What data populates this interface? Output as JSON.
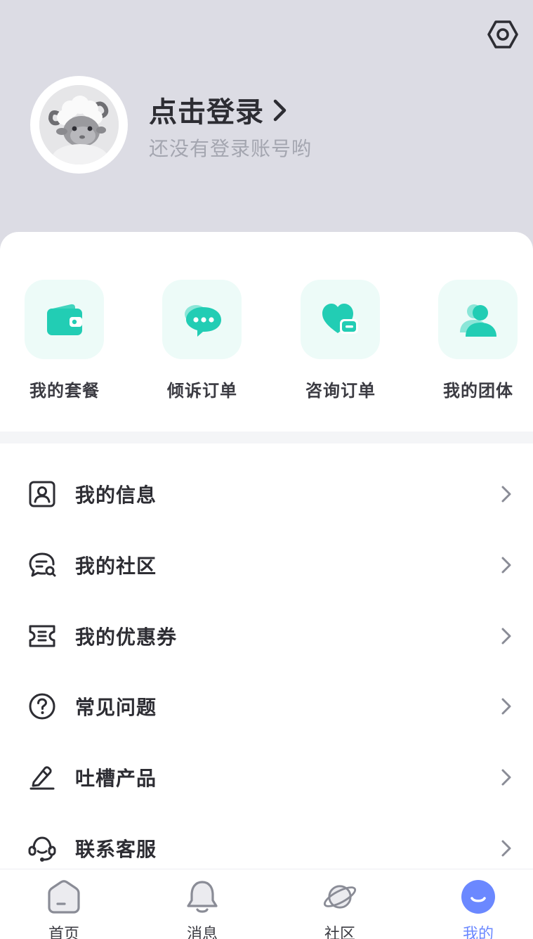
{
  "header": {
    "login_title": "点击登录",
    "login_subtitle": "还没有登录账号哟",
    "settings_icon": "settings-hexagon-icon",
    "avatar_icon": "sheep-avatar"
  },
  "quick_actions": [
    {
      "label": "我的套餐",
      "icon": "wallet-icon"
    },
    {
      "label": "倾诉订单",
      "icon": "chat-bubble-icon"
    },
    {
      "label": "咨询订单",
      "icon": "heart-message-icon"
    },
    {
      "label": "我的团体",
      "icon": "group-people-icon"
    }
  ],
  "menu": [
    {
      "label": "我的信息",
      "icon": "user-card-icon"
    },
    {
      "label": "我的社区",
      "icon": "chat-search-icon"
    },
    {
      "label": "我的优惠券",
      "icon": "ticket-icon"
    },
    {
      "label": "常见问题",
      "icon": "question-circle-icon"
    },
    {
      "label": "吐槽产品",
      "icon": "pencil-edit-icon"
    },
    {
      "label": "联系客服",
      "icon": "headset-icon"
    }
  ],
  "tabs": [
    {
      "label": "首页",
      "icon": "home-icon",
      "active": false
    },
    {
      "label": "消息",
      "icon": "bell-icon",
      "active": false
    },
    {
      "label": "社区",
      "icon": "planet-icon",
      "active": false
    },
    {
      "label": "我的",
      "icon": "smile-face-icon",
      "active": true
    }
  ],
  "colors": {
    "header_bg": "#dcdce4",
    "accent_green": "#22cdb4",
    "tile_bg": "#edfbf8",
    "active_tab": "#6b88ff"
  }
}
